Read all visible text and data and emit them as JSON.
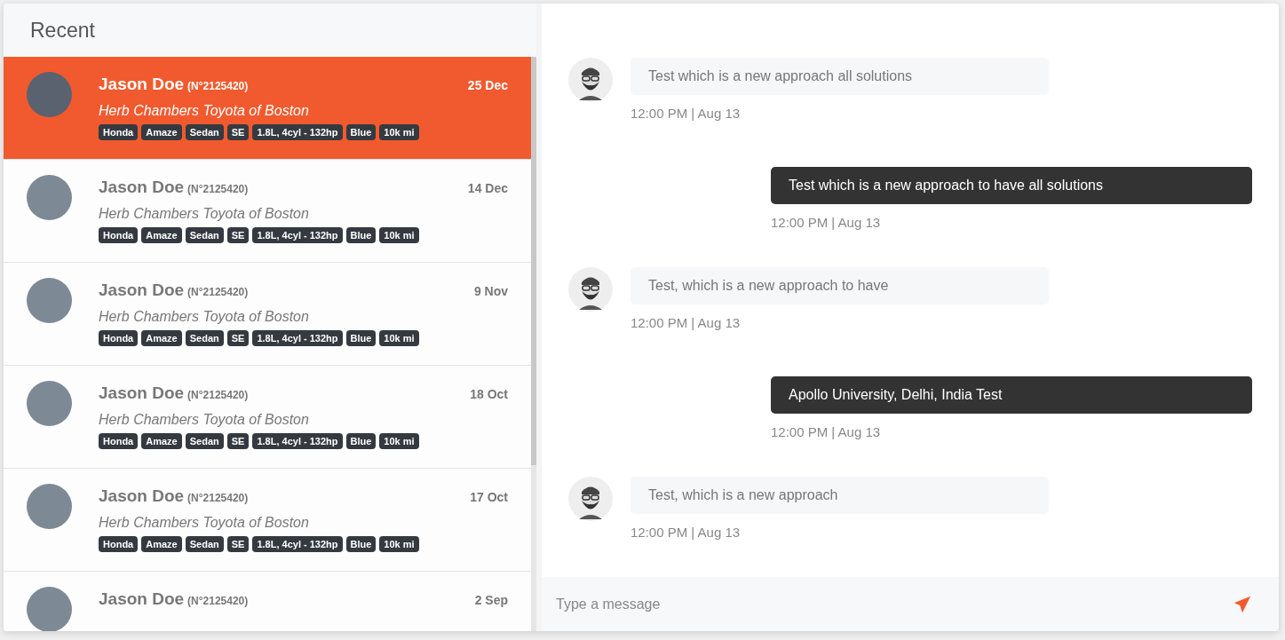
{
  "recent": {
    "title": "Recent",
    "items": [
      {
        "name": "Jason Doe",
        "number": "(N°2125420)",
        "date": "25 Dec",
        "dealer": "Herb Chambers Toyota of Boston",
        "tags": [
          "Honda",
          "Amaze",
          "Sedan",
          "SE",
          "1.8L, 4cyl - 132hp",
          "Blue",
          "10k mi"
        ],
        "selected": true
      },
      {
        "name": "Jason Doe",
        "number": "(N°2125420)",
        "date": "14 Dec",
        "dealer": "Herb Chambers Toyota of Boston",
        "tags": [
          "Honda",
          "Amaze",
          "Sedan",
          "SE",
          "1.8L, 4cyl - 132hp",
          "Blue",
          "10k mi"
        ],
        "selected": false
      },
      {
        "name": "Jason Doe",
        "number": "(N°2125420)",
        "date": "9 Nov",
        "dealer": "Herb Chambers Toyota of Boston",
        "tags": [
          "Honda",
          "Amaze",
          "Sedan",
          "SE",
          "1.8L, 4cyl - 132hp",
          "Blue",
          "10k mi"
        ],
        "selected": false
      },
      {
        "name": "Jason Doe",
        "number": "(N°2125420)",
        "date": "18 Oct",
        "dealer": "Herb Chambers Toyota of Boston",
        "tags": [
          "Honda",
          "Amaze",
          "Sedan",
          "SE",
          "1.8L, 4cyl - 132hp",
          "Blue",
          "10k mi"
        ],
        "selected": false
      },
      {
        "name": "Jason Doe",
        "number": "(N°2125420)",
        "date": "17 Oct",
        "dealer": "Herb Chambers Toyota of Boston",
        "tags": [
          "Honda",
          "Amaze",
          "Sedan",
          "SE",
          "1.8L, 4cyl - 132hp",
          "Blue",
          "10k mi"
        ],
        "selected": false
      },
      {
        "name": "Jason Doe",
        "number": "(N°2125420)",
        "date": "2 Sep",
        "selected": false
      }
    ]
  },
  "messages": [
    {
      "kind": "incoming",
      "text": "Test which is a new approach all solutions",
      "time": "12:00 PM | Aug 13"
    },
    {
      "kind": "outgoing",
      "text": "Test which is a new approach to have all solutions",
      "time": "12:00 PM | Aug 13"
    },
    {
      "kind": "incoming",
      "text": "Test, which is a new approach to have",
      "time": "12:00 PM | Aug 13"
    },
    {
      "kind": "outgoing",
      "text": "Apollo University, Delhi, India Test",
      "time": "12:00 PM | Aug 13"
    },
    {
      "kind": "incoming",
      "text": "Test, which is a new approach",
      "time": "12:00 PM | Aug 13"
    }
  ],
  "composer": {
    "placeholder": "Type a message"
  }
}
